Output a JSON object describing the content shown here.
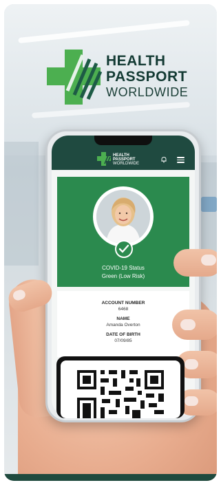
{
  "logo": {
    "line1": "HEALTH",
    "line2": "PASSPORT",
    "line3": "WORLDWIDE",
    "mark_icon": "cross-stripes-logo-icon"
  },
  "app": {
    "header_logo": {
      "line1": "HEALTH",
      "line2": "PASSPORT",
      "line3": "WORLDWIDE"
    },
    "icons": {
      "notifications": "bell-icon",
      "menu": "hamburger-menu-icon",
      "verified": "checkmark-icon"
    },
    "status": {
      "title": "COVID-19 Status",
      "value": "Green (Low Risk)"
    },
    "account": {
      "number_label": "ACCOUNT NUMBER",
      "number": "6468",
      "name_label": "NAME",
      "name": "Amanda Overton",
      "dob_label": "DATE OF BIRTH",
      "dob": "07/09/85"
    }
  },
  "colors": {
    "brand_green": "#2b8a4e",
    "header_dark_green": "#1f4a40",
    "logo_light_green": "#4caf50"
  }
}
